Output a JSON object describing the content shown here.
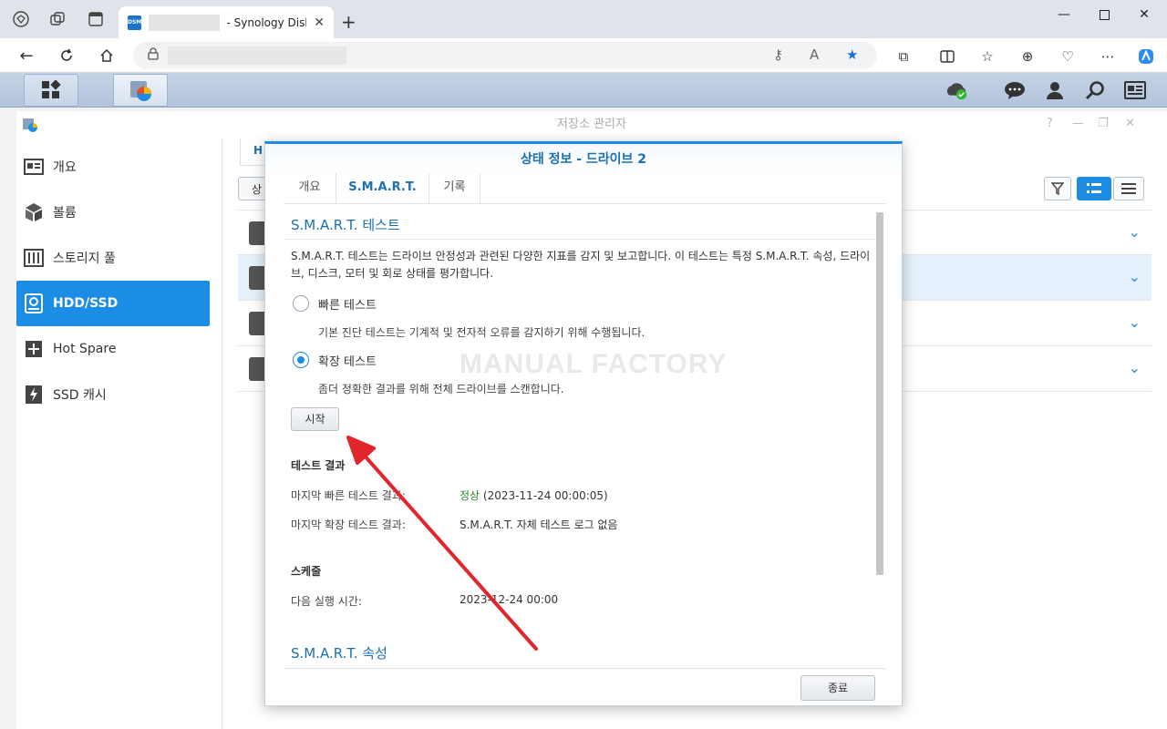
{
  "browser": {
    "tab_title": "- Synology DiskS",
    "tab_favicon": "DSM"
  },
  "app": {
    "title": "저장소 관리자",
    "sidebar": [
      {
        "label": "개요",
        "icon": "overview-icon"
      },
      {
        "label": "볼륨",
        "icon": "volume-icon"
      },
      {
        "label": "스토리지 풀",
        "icon": "storage-pool-icon"
      },
      {
        "label": "HDD/SSD",
        "icon": "hdd-icon"
      },
      {
        "label": "Hot Spare",
        "icon": "hot-spare-icon"
      },
      {
        "label": "SSD 캐시",
        "icon": "ssd-cache-icon"
      }
    ],
    "content_tab_partial": "H",
    "action_btn_partial": "상"
  },
  "modal": {
    "title": "상태 정보 - 드라이브 2",
    "tabs": [
      "개요",
      "S.M.A.R.T.",
      "기록"
    ],
    "smart_test": {
      "heading": "S.M.A.R.T. 테스트",
      "description": "S.M.A.R.T. 테스트는 드라이브 안정성과 관련된 다양한 지표를 감지 및 보고합니다. 이 테스트는 특정 S.M.A.R.T. 속성, 드라이브, 디스크, 모터 및 회로 상태를 평가합니다.",
      "quick_label": "빠른 테스트",
      "quick_desc": "기본 진단 테스트는 기계적 및 전자적 오류를 감지하기 위해 수행됩니다.",
      "extended_label": "확장 테스트",
      "extended_desc": "좀더 정확한 결과를 위해 전체 드라이브를 스캔합니다.",
      "start_button": "시작"
    },
    "results": {
      "heading": "테스트 결과",
      "last_quick_label": "마지막 빠른 테스트 결과:",
      "last_quick_status": "정상",
      "last_quick_time": "(2023-11-24 00:00:05)",
      "last_extended_label": "마지막 확장 테스트 결과:",
      "last_extended_value": "S.M.A.R.T. 자체 테스트 로그 없음"
    },
    "schedule": {
      "heading": "스케줄",
      "next_run_label": "다음 실행 시간:",
      "next_run_value": "2023-12-24 00:00"
    },
    "attributes_heading": "S.M.A.R.T. 속성",
    "close_button": "종료"
  },
  "watermark": "MANUAL FACTORY",
  "colors": {
    "accent": "#1b8de5",
    "ok": "#2a8a2a",
    "arrow": "#e0262b"
  }
}
